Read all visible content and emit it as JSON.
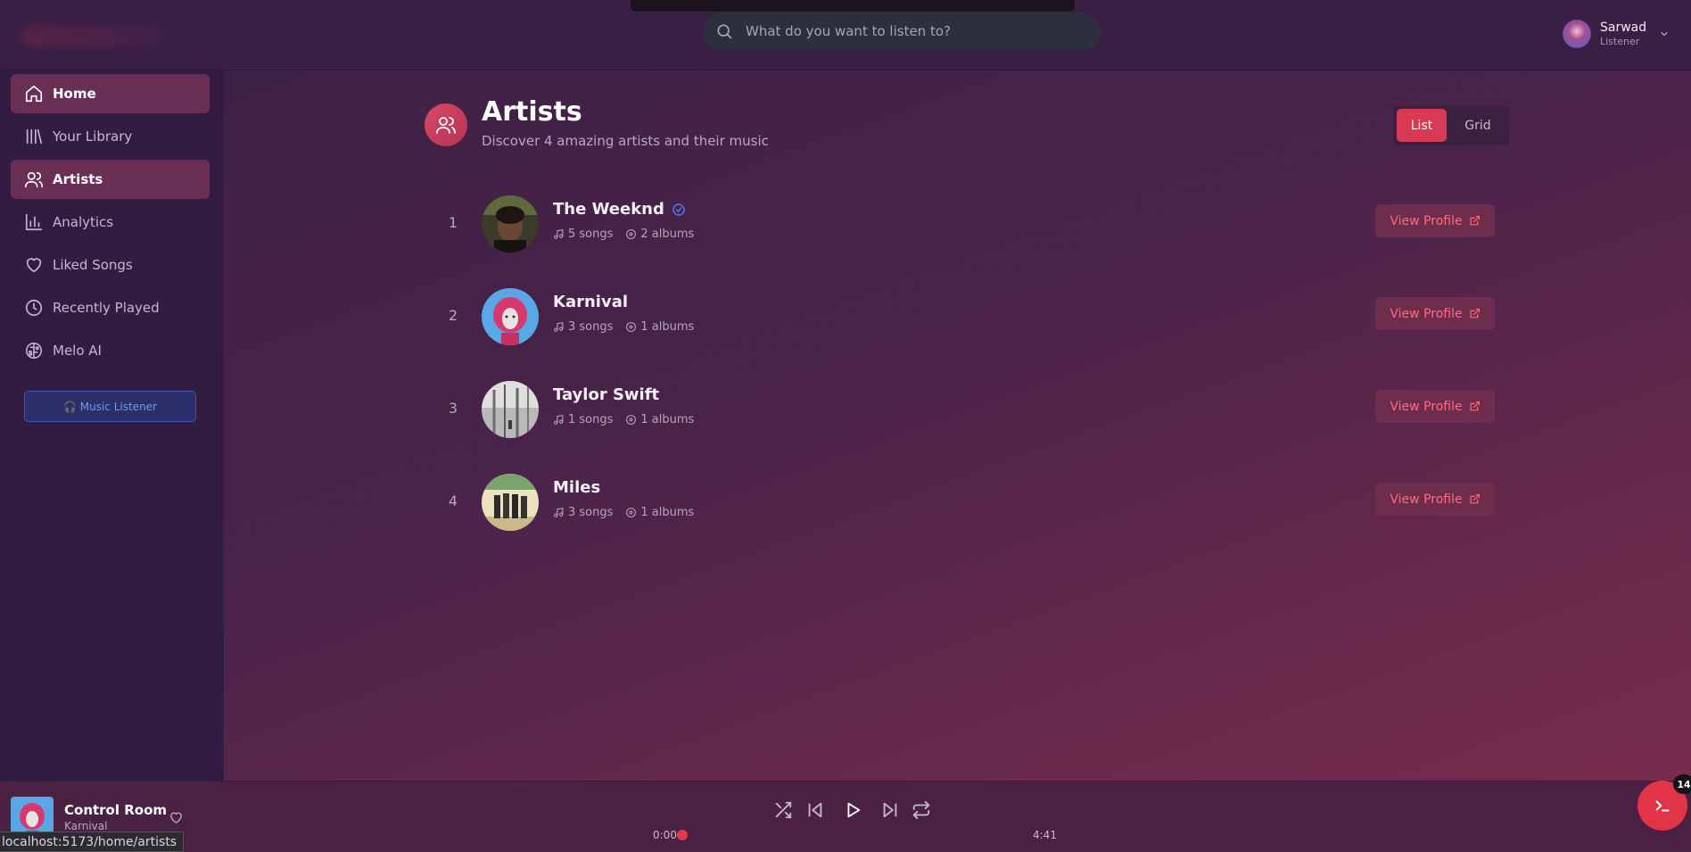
{
  "header": {
    "search_placeholder": "What do you want to listen to?",
    "user": {
      "name": "Sarwad",
      "role": "Listener"
    }
  },
  "sidebar": {
    "items": [
      {
        "label": "Home",
        "icon": "home-icon",
        "active": true
      },
      {
        "label": "Your Library",
        "icon": "library-icon",
        "active": false
      },
      {
        "label": "Artists",
        "icon": "users-icon",
        "active": true
      },
      {
        "label": "Analytics",
        "icon": "bar-chart-icon",
        "active": false
      },
      {
        "label": "Liked Songs",
        "icon": "heart-icon",
        "active": false
      },
      {
        "label": "Recently Played",
        "icon": "clock-icon",
        "active": false
      },
      {
        "label": "Melo AI",
        "icon": "brain-icon",
        "active": false
      }
    ],
    "role_badge": "🎧 Music Listener"
  },
  "page": {
    "title": "Artists",
    "subtitle": "Discover 4 amazing artists and their music",
    "view_toggle": {
      "list": "List",
      "grid": "Grid",
      "selected": "List"
    }
  },
  "artists": [
    {
      "rank": "1",
      "name": "The Weeknd",
      "verified": true,
      "songs": "5 songs",
      "albums": "2 albums",
      "action": "View Profile"
    },
    {
      "rank": "2",
      "name": "Karnival",
      "verified": false,
      "songs": "3 songs",
      "albums": "1 albums",
      "action": "View Profile"
    },
    {
      "rank": "3",
      "name": "Taylor Swift",
      "verified": false,
      "songs": "1 songs",
      "albums": "1 albums",
      "action": "View Profile"
    },
    {
      "rank": "4",
      "name": "Miles",
      "verified": false,
      "songs": "3 songs",
      "albums": "1 albums",
      "action": "View Profile"
    }
  ],
  "player": {
    "track_title": "Control Room",
    "track_artist": "Karnival",
    "current_time": "0:00",
    "duration": "4:41",
    "progress_fraction": 0
  },
  "status_bar_url": "localhost:5173/home/artists",
  "fab": {
    "badge": "14"
  },
  "colors": {
    "accent": "#d73a52",
    "verified": "#4f7cf0",
    "role_badge": "#6d9af5"
  }
}
